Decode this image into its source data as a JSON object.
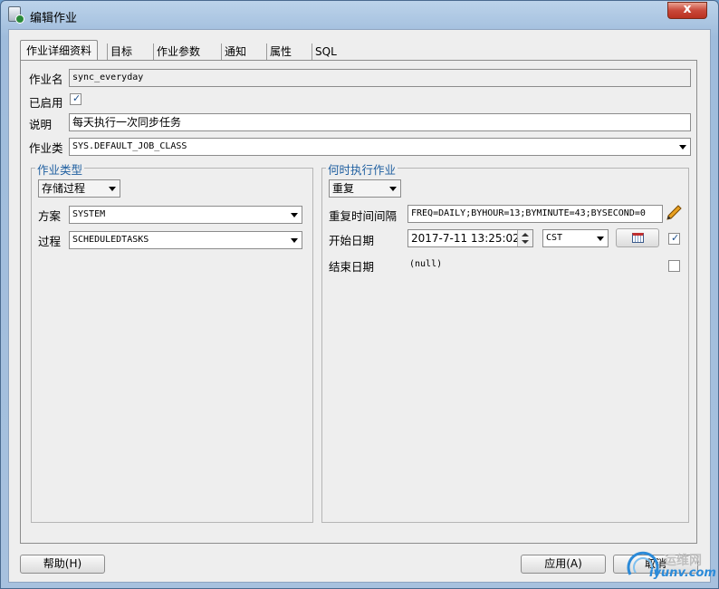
{
  "window": {
    "title": "编辑作业",
    "close_symbol": "x",
    "icon": "database-job-icon"
  },
  "tabs": [
    {
      "label": "作业详细资料",
      "active": true
    },
    {
      "label": "目标",
      "active": false
    },
    {
      "label": "作业参数",
      "active": false
    },
    {
      "label": "通知",
      "active": false
    },
    {
      "label": "属性",
      "active": false
    },
    {
      "label": "SQL",
      "active": false
    }
  ],
  "details": {
    "job_name_label": "作业名",
    "job_name_value": "sync_everyday",
    "enabled_label": "已启用",
    "enabled_checked": true,
    "description_label": "说明",
    "description_value": "每天执行一次同步任务",
    "job_class_label": "作业类",
    "job_class_value": "SYS.DEFAULT_JOB_CLASS"
  },
  "job_type": {
    "title": "作业类型",
    "type_value": "存储过程",
    "schema_label": "方案",
    "schema_value": "SYSTEM",
    "procedure_label": "过程",
    "procedure_value": "SCHEDULEDTASKS"
  },
  "schedule": {
    "title": "何时执行作业",
    "mode_value": "重复",
    "interval_label": "重复时间间隔",
    "interval_value": "FREQ=DAILY;BYHOUR=13;BYMINUTE=43;BYSECOND=0",
    "start_label": "开始日期",
    "start_value": "2017-7-11 13:25:02",
    "timezone_value": "CST",
    "start_checked": true,
    "end_label": "结束日期",
    "end_value": "(null)",
    "end_checked": false
  },
  "buttons": {
    "help": "帮助(H)",
    "apply": "应用(A)",
    "cancel": "取消"
  },
  "watermark": {
    "line1": "运维网",
    "line2": "iyunv.com"
  },
  "colors": {
    "group_title": "#1f5fa0",
    "close_button": "#c9483a"
  }
}
